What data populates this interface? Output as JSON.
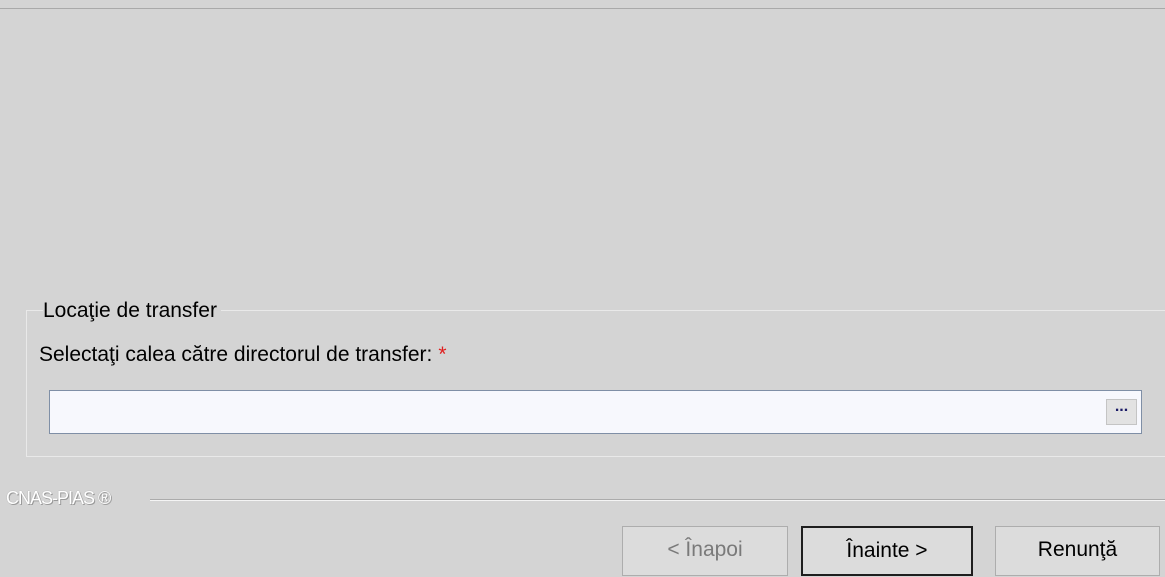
{
  "transfer_group": {
    "title": "Locaţie de transfer",
    "field_label": "Selectaţi calea către directorul de transfer:",
    "required_marker": "*",
    "path_value": "",
    "browse_label": "..."
  },
  "brand": {
    "text": "CNAS-PIAS ®"
  },
  "buttons": {
    "back_label": "< Înapoi",
    "back_enabled": false,
    "next_label": "Înainte >",
    "cancel_label": "Renunţă"
  },
  "colors": {
    "background": "#d4d4d4",
    "required": "#e02020",
    "input_background": "#f7f8fd"
  }
}
